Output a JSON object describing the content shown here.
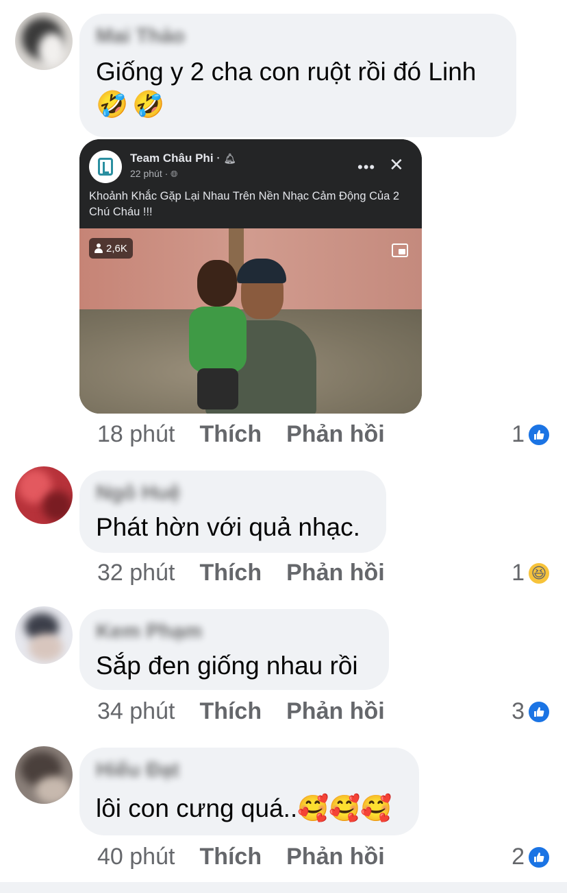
{
  "comments": [
    {
      "name": "Mai Thảo",
      "text": "Giống y 2 cha con ruột rồi đó Linh",
      "emojis": [
        "🤣",
        "🤣"
      ],
      "time": "18 phút",
      "like_label": "Thích",
      "reply_label": "Phản hồi",
      "reaction_count": "1",
      "reaction_icon": "like-icon"
    },
    {
      "name": "Ngô Huệ",
      "text": "Phát hờn với quả nhạc.",
      "time": "32 phút",
      "like_label": "Thích",
      "reply_label": "Phản hồi",
      "reaction_count": "1",
      "reaction_icon": "haha-icon"
    },
    {
      "name": "Kem Phạm",
      "text": "Sắp đen giống nhau rồi",
      "time": "34 phút",
      "like_label": "Thích",
      "reply_label": "Phản hồi",
      "reaction_count": "3",
      "reaction_icon": "like-icon"
    },
    {
      "name": "Hiếu Đạt",
      "text": "lôi con cưng quá..🥰🥰🥰",
      "time": "40 phút",
      "like_label": "Thích",
      "reply_label": "Phản hồi",
      "reaction_count": "2",
      "reaction_icon": "like-icon"
    }
  ],
  "shared_post": {
    "page_name": "Team Châu Phi",
    "page_name_suffix": "·",
    "time": "22 phút ·",
    "text": "Khoảnh Khắc Gặp Lại Nhau Trên Nền Nhạc Cảm Động Của 2 Chú Cháu !!!",
    "view_count": "2,6K",
    "more_label": "•••",
    "close_label": "✕"
  },
  "colors": {
    "bubble": "#f0f2f5",
    "secondary_text": "#65676b",
    "like_blue": "#1b74e4",
    "card_bg": "#242526"
  }
}
